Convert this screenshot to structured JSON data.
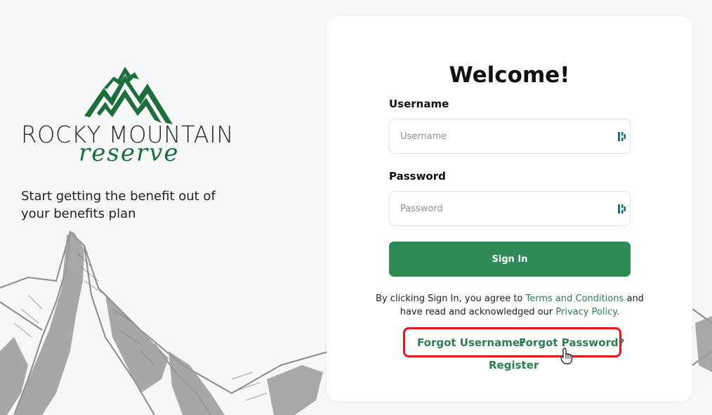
{
  "brand": {
    "name_line1": "ROCKY MOUNTAIN",
    "name_line2": "reserve",
    "tagline": "Start getting the benefit out of your benefits plan",
    "logo_icon": "mountain-peaks-icon",
    "brand_color": "#1d6e3a"
  },
  "login": {
    "title": "Welcome!",
    "username_label": "Username",
    "username_placeholder": "Username",
    "password_label": "Password",
    "password_placeholder": "Password",
    "password_manager_icon": "password-manager-icon",
    "signin_label": "Sign In",
    "legal_prefix": "By clicking Sign In, you agree to ",
    "terms_link": "Terms and Conditions",
    "legal_middle": " and have read and acknowledged our ",
    "privacy_link": "Privacy Policy.",
    "forgot_username": "Forgot Username?",
    "forgot_password": "Forgot Password?",
    "register": "Register"
  },
  "colors": {
    "accent": "#2e8b57",
    "link": "#2e7d4f",
    "highlight_border": "#e01820",
    "background": "#f6f7f9"
  }
}
